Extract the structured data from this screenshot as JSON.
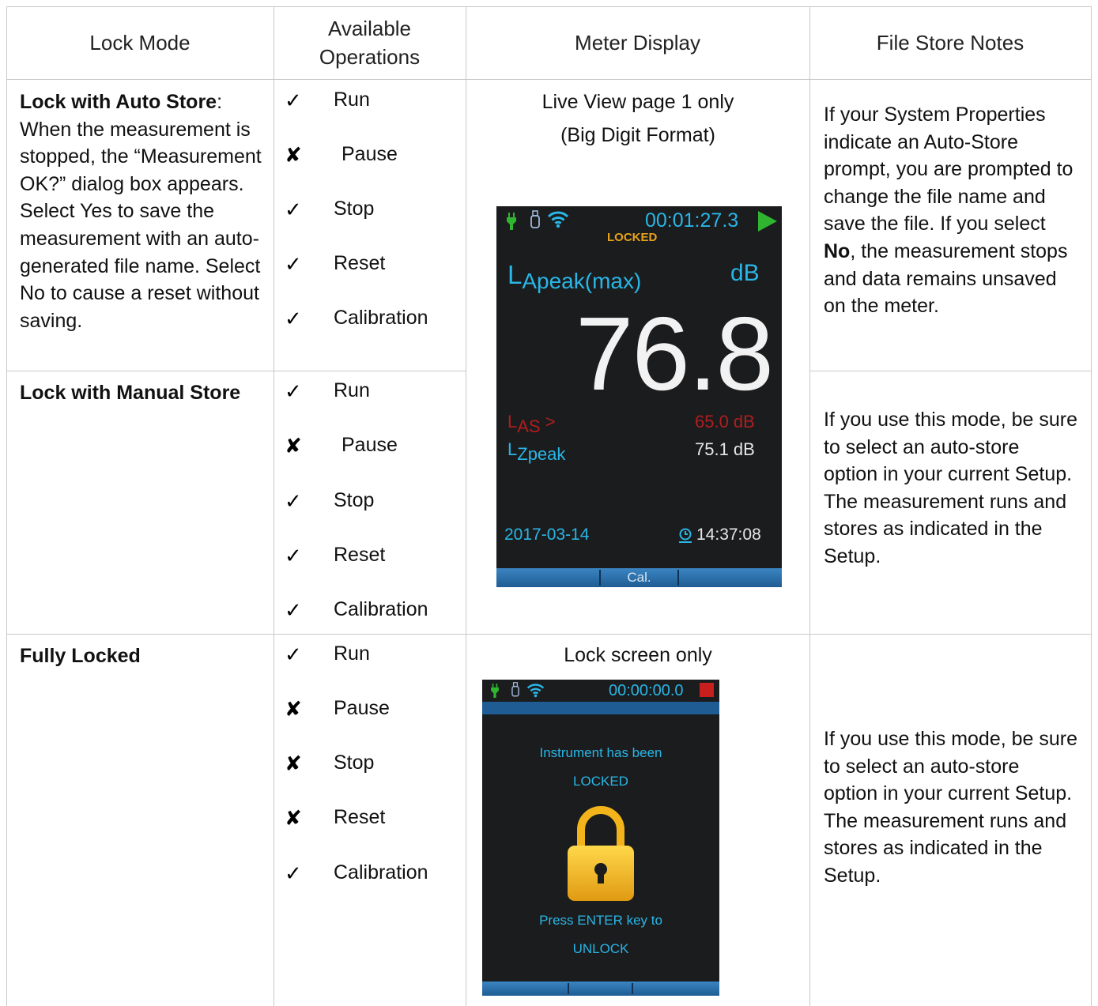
{
  "headers": [
    "Lock Mode",
    "Available\nOperations",
    "Meter Display",
    "File Store Notes"
  ],
  "header_lines": {
    "ops_line1": "Available",
    "ops_line2": "Operations"
  },
  "rows": {
    "auto": {
      "mode_title": "Lock with Auto Store",
      "mode_colon": ":",
      "mode_desc": "When the measurement is stopped, the “Measurement OK?” dialog box appears. Select Yes to save the measurement with an auto-generated file name. Select No to cause a reset without saving.",
      "ops": [
        {
          "label": "Run",
          "mark": "✓"
        },
        {
          "label": "Pause",
          "mark": "✘"
        },
        {
          "label": "Stop",
          "mark": "✓"
        },
        {
          "label": "Reset",
          "mark": "✓"
        },
        {
          "label": "Calibration",
          "mark": "✓"
        }
      ],
      "notes_pre": "If your System Properties indicate an Auto-Store prompt, you are prompted to change the file name and save the file. If you select ",
      "notes_bold": "No",
      "notes_post": ", the measurement stops and data remains unsaved on the meter."
    },
    "manual": {
      "mode_title": "Lock with Manual Store",
      "ops": [
        {
          "label": "Run",
          "mark": "✓"
        },
        {
          "label": "Pause",
          "mark": "✘"
        },
        {
          "label": "Stop",
          "mark": "✓"
        },
        {
          "label": "Reset",
          "mark": "✓"
        },
        {
          "label": "Calibration",
          "mark": "✓"
        }
      ],
      "notes": "If you use this mode, be sure to select an auto-store option in your current Setup. The measurement runs and stores as indicated in the Setup."
    },
    "full": {
      "mode_title": "Fully Locked",
      "ops": [
        {
          "label": "Run",
          "mark": "✓"
        },
        {
          "label": "Pause",
          "mark": "✘"
        },
        {
          "label": "Stop",
          "mark": "✘"
        },
        {
          "label": "Reset",
          "mark": "✘"
        },
        {
          "label": "Calibration",
          "mark": "✓"
        }
      ],
      "notes": "If you use this mode, be sure to select an auto-store option in your current Setup. The measurement runs and stores as indicated in the Setup."
    }
  },
  "display1": {
    "caption_line1": "Live View page 1 only",
    "caption_line2": "(Big Digit Format)",
    "timer": "00:01:27.3",
    "locked": "LOCKED",
    "metric_main": "L",
    "metric_sub": "Apeak(max)",
    "unit": "dB",
    "big_value": "76.8",
    "las_main": "L",
    "las_sub": "AS",
    "las_arrow": ">",
    "las_value": "65.0 dB",
    "lz_main": "L",
    "lz_sub": "Zpeak",
    "lz_value": "75.1 dB",
    "date": "2017-03-14",
    "time": "14:37:08",
    "softkey": "Cal.",
    "colors": {
      "green": "#2fb52f",
      "orange": "#e8a21a",
      "red": "#b01e1e",
      "cyan": "#29b6e6"
    }
  },
  "display2": {
    "caption": "Lock screen only",
    "timer": "00:00:00.0",
    "line1": "Instrument has been",
    "line2": "LOCKED",
    "line3": "Press ENTER key to",
    "line4": "UNLOCK",
    "colors": {
      "lock": "#f2b41a",
      "stop": "#c81e1e"
    }
  },
  "icons": [
    "plug-icon",
    "usb-icon",
    "wifi-icon",
    "play-icon",
    "stop-icon",
    "clock-icon",
    "padlock-icon",
    "check-icon",
    "cross-icon"
  ]
}
